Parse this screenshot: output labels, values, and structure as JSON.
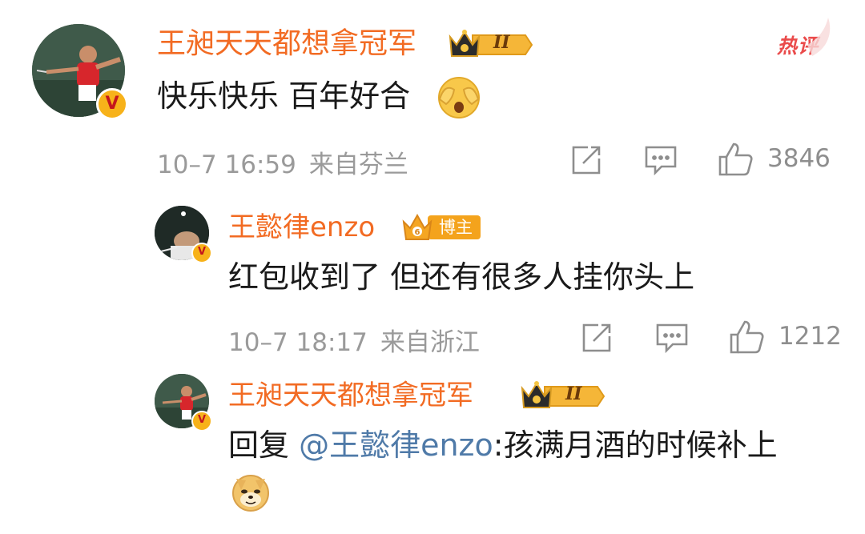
{
  "comment": {
    "username": "王昶天天都想拿冠军",
    "level_badge": "II",
    "hot_tag": "热评",
    "text": "快乐快乐 百年好合",
    "emoji": "cover-face-emoji",
    "date": "10–7 16:59",
    "location": "来自芬兰",
    "likes": "3846"
  },
  "replies": [
    {
      "username": "王懿律enzo",
      "badge": "博主",
      "text": "红包收到了  但还有很多人挂你头上",
      "date": "10–7 18:17",
      "location": "来自浙江",
      "likes": "1212"
    },
    {
      "username": "王昶天天都想拿冠军",
      "level_badge": "II",
      "reply_prefix": "回复 ",
      "mention": "@王懿律enzo",
      "text": ":孩满月酒的时候补上",
      "emoji": "doge-emoji"
    }
  ],
  "colors": {
    "username": "#f26b23",
    "mention": "#4f7aa8",
    "meta": "#9a9a9a",
    "hot": "#ea4b4b"
  }
}
